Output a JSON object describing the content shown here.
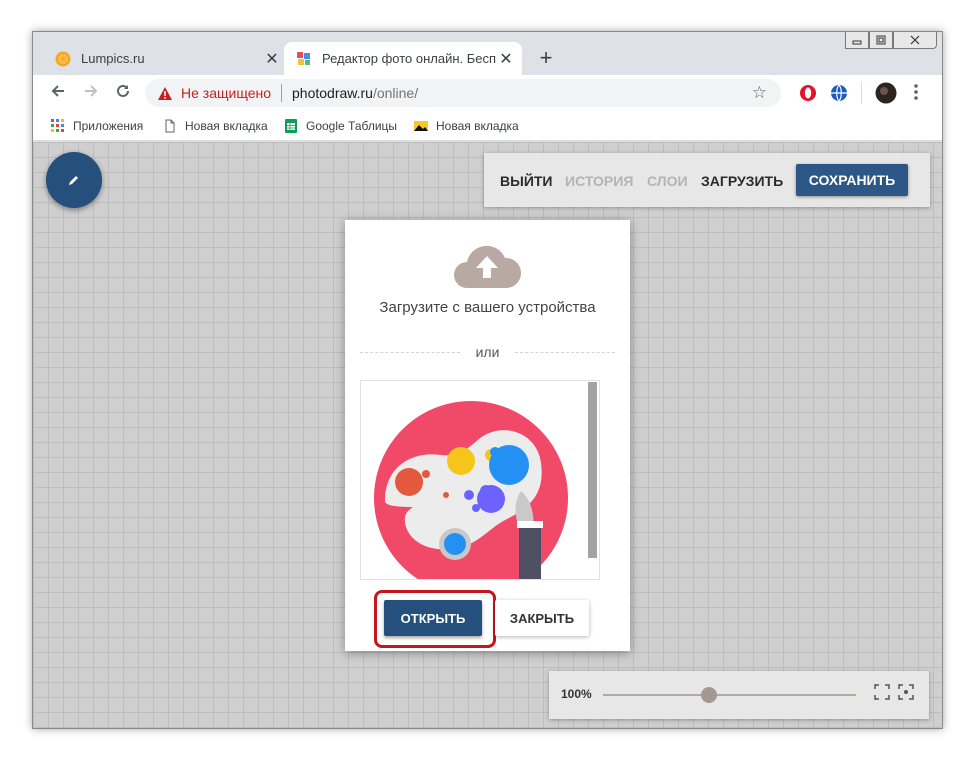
{
  "browser": {
    "tabs": [
      {
        "title": "Lumpics.ru",
        "favicon": "lumpics-orange-icon",
        "active": false
      },
      {
        "title": "Редактор фото онлайн. Бесплат",
        "favicon": "photodraw-icon",
        "active": true
      }
    ],
    "new_tab": "+",
    "close_tab": "✕",
    "security_text": "Не защищено",
    "url_host": "photodraw.ru",
    "url_path": "/online/",
    "bookmarks": [
      {
        "label": "Приложения",
        "icon": "apps-grid-icon"
      },
      {
        "label": "Новая вкладка",
        "icon": "page-icon"
      },
      {
        "label": "Google Таблицы",
        "icon": "sheets-icon"
      },
      {
        "label": "Новая вкладка",
        "icon": "image-icon"
      }
    ]
  },
  "editor": {
    "menu": {
      "exit": "ВЫЙТИ",
      "history": "ИСТОРИЯ",
      "layers": "СЛОИ",
      "upload": "ЗАГРУЗИТЬ",
      "save": "СОХРАНИТЬ"
    },
    "dialog": {
      "upload_text": "Загрузите с вашего устройства",
      "or_text": "или",
      "open_button": "ОТКРЫТЬ",
      "close_button": "ЗАКРЫТЬ"
    },
    "zoom": {
      "value": "100%",
      "level": 0.42
    }
  },
  "colors": {
    "primary": "#254f7c",
    "highlight": "#c4161c",
    "palette_bg": "#f04a68"
  }
}
